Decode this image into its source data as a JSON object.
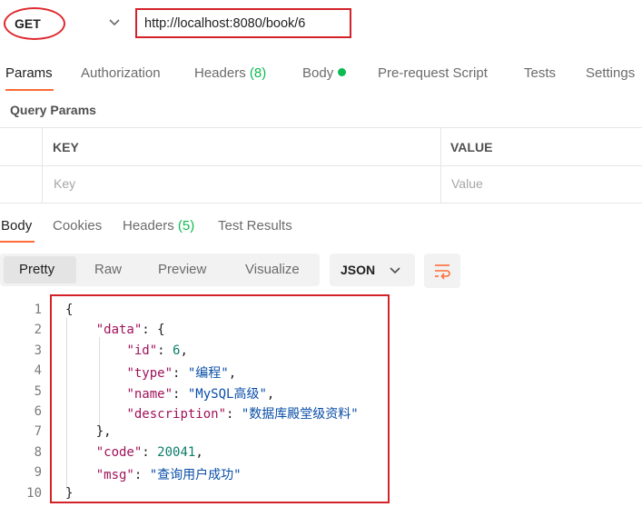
{
  "request": {
    "method": "GET",
    "url": "http://localhost:8080/book/6"
  },
  "request_tabs": [
    {
      "label": "Params",
      "count": "",
      "active": true
    },
    {
      "label": "Authorization",
      "count": "",
      "active": false
    },
    {
      "label": "Headers",
      "count": "(8)",
      "active": false
    },
    {
      "label": "Body",
      "count": "",
      "active": false
    },
    {
      "label": "Pre-request Script",
      "count": "",
      "active": false
    },
    {
      "label": "Tests",
      "count": "",
      "active": false
    },
    {
      "label": "Settings",
      "count": "",
      "active": false
    }
  ],
  "query_params": {
    "title": "Query Params",
    "key_header": "KEY",
    "value_header": "VALUE",
    "key_placeholder": "Key",
    "value_placeholder": "Value"
  },
  "response_tabs": [
    {
      "label": "Body",
      "count": "",
      "active": true
    },
    {
      "label": "Cookies",
      "count": "",
      "active": false
    },
    {
      "label": "Headers",
      "count": "(5)",
      "active": false
    },
    {
      "label": "Test Results",
      "count": "",
      "active": false
    }
  ],
  "view_modes": [
    "Pretty",
    "Raw",
    "Preview",
    "Visualize"
  ],
  "active_view": "Pretty",
  "format": "JSON",
  "colors": {
    "accent": "#ff6c37",
    "count": "#0cbb52",
    "highlight": "#d32229"
  },
  "code_lines": [
    {
      "n": "1",
      "tokens": [
        {
          "t": "{",
          "c": "p"
        }
      ]
    },
    {
      "n": "2",
      "tokens": [
        {
          "t": "    ",
          "c": "p"
        },
        {
          "t": "\"data\"",
          "c": "k"
        },
        {
          "t": ": {",
          "c": "p"
        }
      ]
    },
    {
      "n": "3",
      "tokens": [
        {
          "t": "        ",
          "c": "p"
        },
        {
          "t": "\"id\"",
          "c": "k"
        },
        {
          "t": ": ",
          "c": "p"
        },
        {
          "t": "6",
          "c": "n"
        },
        {
          "t": ",",
          "c": "p"
        }
      ]
    },
    {
      "n": "4",
      "tokens": [
        {
          "t": "        ",
          "c": "p"
        },
        {
          "t": "\"type\"",
          "c": "k"
        },
        {
          "t": ": ",
          "c": "p"
        },
        {
          "t": "\"编程\"",
          "c": "s"
        },
        {
          "t": ",",
          "c": "p"
        }
      ]
    },
    {
      "n": "5",
      "tokens": [
        {
          "t": "        ",
          "c": "p"
        },
        {
          "t": "\"name\"",
          "c": "k"
        },
        {
          "t": ": ",
          "c": "p"
        },
        {
          "t": "\"MySQL高级\"",
          "c": "s"
        },
        {
          "t": ",",
          "c": "p"
        }
      ]
    },
    {
      "n": "6",
      "tokens": [
        {
          "t": "        ",
          "c": "p"
        },
        {
          "t": "\"description\"",
          "c": "k"
        },
        {
          "t": ": ",
          "c": "p"
        },
        {
          "t": "\"数据库殿堂级资料\"",
          "c": "s"
        }
      ]
    },
    {
      "n": "7",
      "tokens": [
        {
          "t": "    },",
          "c": "p"
        }
      ]
    },
    {
      "n": "8",
      "tokens": [
        {
          "t": "    ",
          "c": "p"
        },
        {
          "t": "\"code\"",
          "c": "k"
        },
        {
          "t": ": ",
          "c": "p"
        },
        {
          "t": "20041",
          "c": "n"
        },
        {
          "t": ",",
          "c": "p"
        }
      ]
    },
    {
      "n": "9",
      "tokens": [
        {
          "t": "    ",
          "c": "p"
        },
        {
          "t": "\"msg\"",
          "c": "k"
        },
        {
          "t": ": ",
          "c": "p"
        },
        {
          "t": "\"查询用户成功\"",
          "c": "s"
        }
      ]
    },
    {
      "n": "10",
      "tokens": [
        {
          "t": "}",
          "c": "p"
        }
      ]
    }
  ]
}
